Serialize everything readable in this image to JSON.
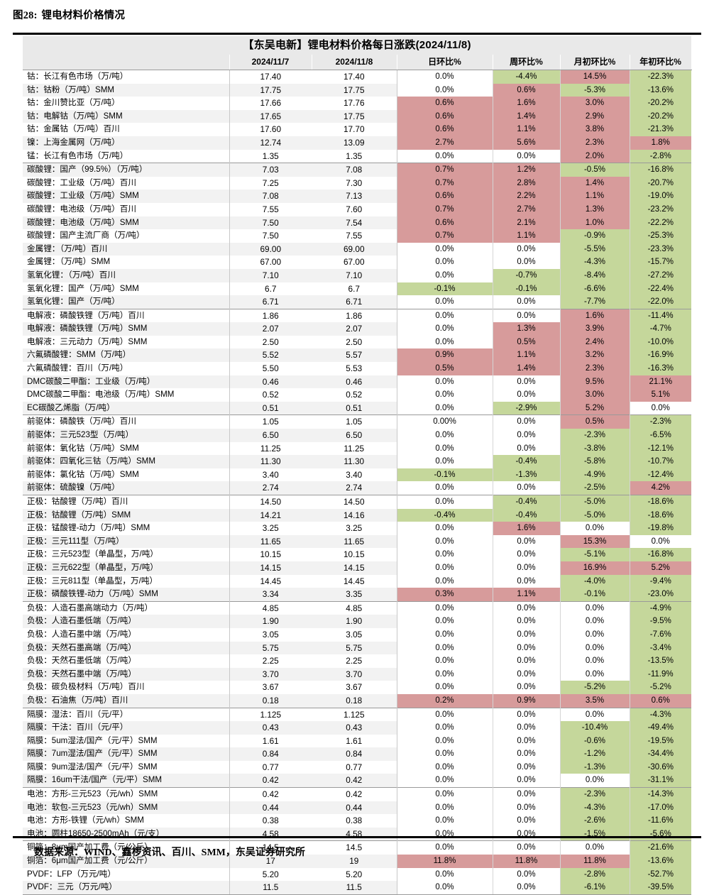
{
  "figure": {
    "number": "图28:",
    "caption": "锂电材料价格情况"
  },
  "source": {
    "text": "数据来源：WIND、鑫椤资讯、百川、SMM，东吴证券研究所"
  },
  "colors": {
    "up": "#d79b9b",
    "down": "#c5d79b",
    "flat": "#ffffff",
    "header_bg": "#e9e9e9",
    "stripe_bg": "#f2f2f2"
  },
  "table": {
    "title": "【东吴电新】锂电材料价格每日涨跌(2024/11/8)",
    "columns": [
      "",
      "2024/11/7",
      "2024/11/8",
      "日环比%",
      "周环比%",
      "月初环比%",
      "年初环比%"
    ],
    "rows": [
      {
        "name": "钴：长江有色市场（万/吨）",
        "v1": "17.40",
        "v2": "17.40",
        "d": "0.0%",
        "w": "-4.4%",
        "m": "14.5%",
        "y": "-22.3%",
        "dc": "flat",
        "wc": "down",
        "mc": "up",
        "yc": "down",
        "group": 1
      },
      {
        "name": "钴：钴粉（万/吨）SMM",
        "v1": "17.75",
        "v2": "17.75",
        "d": "0.0%",
        "w": "0.6%",
        "m": "-5.3%",
        "y": "-13.6%",
        "dc": "flat",
        "wc": "up",
        "mc": "down",
        "yc": "down",
        "group": 1
      },
      {
        "name": "钴：金川赞比亚（万/吨）",
        "v1": "17.66",
        "v2": "17.76",
        "d": "0.6%",
        "w": "1.6%",
        "m": "3.0%",
        "y": "-20.2%",
        "dc": "up",
        "wc": "up",
        "mc": "up",
        "yc": "down",
        "group": 1
      },
      {
        "name": "钴：电解钴（万/吨）SMM",
        "v1": "17.65",
        "v2": "17.75",
        "d": "0.6%",
        "w": "1.4%",
        "m": "2.9%",
        "y": "-20.2%",
        "dc": "up",
        "wc": "up",
        "mc": "up",
        "yc": "down",
        "group": 1
      },
      {
        "name": "钴：金属钴（万/吨）百川",
        "v1": "17.60",
        "v2": "17.70",
        "d": "0.6%",
        "w": "1.1%",
        "m": "3.8%",
        "y": "-21.3%",
        "dc": "up",
        "wc": "up",
        "mc": "up",
        "yc": "down",
        "group": 1
      },
      {
        "name": "镍：上海金属网（万/吨）",
        "v1": "12.74",
        "v2": "13.09",
        "d": "2.7%",
        "w": "5.6%",
        "m": "2.3%",
        "y": "1.8%",
        "dc": "up",
        "wc": "up",
        "mc": "up",
        "yc": "up",
        "group": 1
      },
      {
        "name": "锰：长江有色市场（万/吨）",
        "v1": "1.35",
        "v2": "1.35",
        "d": "0.0%",
        "w": "0.0%",
        "m": "2.0%",
        "y": "-2.8%",
        "dc": "flat",
        "wc": "flat",
        "mc": "up",
        "yc": "down",
        "group": 1
      },
      {
        "name": "碳酸锂：国产（99.5%）（万/吨）",
        "v1": "7.03",
        "v2": "7.08",
        "d": "0.7%",
        "w": "1.2%",
        "m": "-0.5%",
        "y": "-16.8%",
        "dc": "up",
        "wc": "up",
        "mc": "down",
        "yc": "down",
        "group": 2
      },
      {
        "name": "碳酸锂：工业级（万/吨）百川",
        "v1": "7.25",
        "v2": "7.30",
        "d": "0.7%",
        "w": "2.8%",
        "m": "1.4%",
        "y": "-20.7%",
        "dc": "up",
        "wc": "up",
        "mc": "up",
        "yc": "down",
        "group": 2
      },
      {
        "name": "碳酸锂：工业级（万/吨）SMM",
        "v1": "7.08",
        "v2": "7.13",
        "d": "0.6%",
        "w": "2.2%",
        "m": "1.1%",
        "y": "-19.0%",
        "dc": "up",
        "wc": "up",
        "mc": "up",
        "yc": "down",
        "group": 2
      },
      {
        "name": "碳酸锂：电池级（万/吨）百川",
        "v1": "7.55",
        "v2": "7.60",
        "d": "0.7%",
        "w": "2.7%",
        "m": "1.3%",
        "y": "-23.2%",
        "dc": "up",
        "wc": "up",
        "mc": "up",
        "yc": "down",
        "group": 2
      },
      {
        "name": "碳酸锂：电池级（万/吨）SMM",
        "v1": "7.50",
        "v2": "7.54",
        "d": "0.6%",
        "w": "2.1%",
        "m": "1.0%",
        "y": "-22.2%",
        "dc": "up",
        "wc": "up",
        "mc": "up",
        "yc": "down",
        "group": 2
      },
      {
        "name": "碳酸锂：国产主流厂商（万/吨）",
        "v1": "7.50",
        "v2": "7.55",
        "d": "0.7%",
        "w": "1.1%",
        "m": "-0.9%",
        "y": "-25.3%",
        "dc": "up",
        "wc": "up",
        "mc": "down",
        "yc": "down",
        "group": 2
      },
      {
        "name": "金属锂：（万/吨）百川",
        "v1": "69.00",
        "v2": "69.00",
        "d": "0.0%",
        "w": "0.0%",
        "m": "-5.5%",
        "y": "-23.3%",
        "dc": "flat",
        "wc": "flat",
        "mc": "down",
        "yc": "down",
        "group": 2
      },
      {
        "name": "金属锂：（万/吨）SMM",
        "v1": "67.00",
        "v2": "67.00",
        "d": "0.0%",
        "w": "0.0%",
        "m": "-4.3%",
        "y": "-15.7%",
        "dc": "flat",
        "wc": "flat",
        "mc": "down",
        "yc": "down",
        "group": 2
      },
      {
        "name": "氢氧化锂：（万/吨）百川",
        "v1": "7.10",
        "v2": "7.10",
        "d": "0.0%",
        "w": "-0.7%",
        "m": "-8.4%",
        "y": "-27.2%",
        "dc": "flat",
        "wc": "down",
        "mc": "down",
        "yc": "down",
        "group": 2
      },
      {
        "name": "氢氧化锂：国产（万/吨）SMM",
        "v1": "6.7",
        "v2": "6.7",
        "d": "-0.1%",
        "w": "-0.1%",
        "m": "-6.6%",
        "y": "-22.4%",
        "dc": "down",
        "wc": "down",
        "mc": "down",
        "yc": "down",
        "group": 2
      },
      {
        "name": "氢氧化锂：国产（万/吨）",
        "v1": "6.71",
        "v2": "6.71",
        "d": "0.0%",
        "w": "0.0%",
        "m": "-7.7%",
        "y": "-22.0%",
        "dc": "flat",
        "wc": "flat",
        "mc": "down",
        "yc": "down",
        "group": 2
      },
      {
        "name": "电解液：磷酸铁锂（万/吨）百川",
        "v1": "1.86",
        "v2": "1.86",
        "d": "0.0%",
        "w": "0.0%",
        "m": "1.6%",
        "y": "-11.4%",
        "dc": "flat",
        "wc": "flat",
        "mc": "up",
        "yc": "down",
        "group": 3
      },
      {
        "name": "电解液：磷酸铁锂（万/吨）SMM",
        "v1": "2.07",
        "v2": "2.07",
        "d": "0.0%",
        "w": "1.3%",
        "m": "3.9%",
        "y": "-4.7%",
        "dc": "flat",
        "wc": "up",
        "mc": "up",
        "yc": "down",
        "group": 3
      },
      {
        "name": "电解液：三元动力（万/吨）SMM",
        "v1": "2.50",
        "v2": "2.50",
        "d": "0.0%",
        "w": "0.5%",
        "m": "2.4%",
        "y": "-10.0%",
        "dc": "flat",
        "wc": "up",
        "mc": "up",
        "yc": "down",
        "group": 3
      },
      {
        "name": "六氟磷酸锂：SMM（万/吨）",
        "v1": "5.52",
        "v2": "5.57",
        "d": "0.9%",
        "w": "1.1%",
        "m": "3.2%",
        "y": "-16.9%",
        "dc": "up",
        "wc": "up",
        "mc": "up",
        "yc": "down",
        "group": 3
      },
      {
        "name": "六氟磷酸锂：百川（万/吨）",
        "v1": "5.50",
        "v2": "5.53",
        "d": "0.5%",
        "w": "1.4%",
        "m": "2.3%",
        "y": "-16.3%",
        "dc": "up",
        "wc": "up",
        "mc": "up",
        "yc": "down",
        "group": 3
      },
      {
        "name": "DMC碳酸二甲酯：工业级（万/吨）",
        "v1": "0.46",
        "v2": "0.46",
        "d": "0.0%",
        "w": "0.0%",
        "m": "9.5%",
        "y": "21.1%",
        "dc": "flat",
        "wc": "flat",
        "mc": "up",
        "yc": "up",
        "group": 3
      },
      {
        "name": "DMC碳酸二甲酯：电池级（万/吨）SMM",
        "v1": "0.52",
        "v2": "0.52",
        "d": "0.0%",
        "w": "0.0%",
        "m": "3.0%",
        "y": "5.1%",
        "dc": "flat",
        "wc": "flat",
        "mc": "up",
        "yc": "up",
        "group": 3
      },
      {
        "name": "EC碳酸乙烯脂（万/吨）",
        "v1": "0.51",
        "v2": "0.51",
        "d": "0.0%",
        "w": "-2.9%",
        "m": "5.2%",
        "y": "0.0%",
        "dc": "flat",
        "wc": "down",
        "mc": "up",
        "yc": "flat",
        "group": 3
      },
      {
        "name": "前驱体：磷酸铁（万/吨）百川",
        "v1": "1.05",
        "v2": "1.05",
        "d": "0.00%",
        "w": "0.0%",
        "m": "0.5%",
        "y": "-2.3%",
        "dc": "flat",
        "wc": "flat",
        "mc": "up",
        "yc": "down",
        "group": 4
      },
      {
        "name": "前驱体：三元523型（万/吨）",
        "v1": "6.50",
        "v2": "6.50",
        "d": "0.0%",
        "w": "0.0%",
        "m": "-2.3%",
        "y": "-6.5%",
        "dc": "flat",
        "wc": "flat",
        "mc": "down",
        "yc": "down",
        "group": 4
      },
      {
        "name": "前驱体：氧化钴（万/吨）SMM",
        "v1": "11.25",
        "v2": "11.25",
        "d": "0.0%",
        "w": "0.0%",
        "m": "-3.8%",
        "y": "-12.1%",
        "dc": "flat",
        "wc": "flat",
        "mc": "down",
        "yc": "down",
        "group": 4
      },
      {
        "name": "前驱体：四氧化三钴（万/吨）SMM",
        "v1": "11.30",
        "v2": "11.30",
        "d": "0.0%",
        "w": "-0.4%",
        "m": "-5.8%",
        "y": "-10.7%",
        "dc": "flat",
        "wc": "down",
        "mc": "down",
        "yc": "down",
        "group": 4
      },
      {
        "name": "前驱体：氯化钴（万/吨）SMM",
        "v1": "3.40",
        "v2": "3.40",
        "d": "-0.1%",
        "w": "-1.3%",
        "m": "-4.9%",
        "y": "-12.4%",
        "dc": "down",
        "wc": "down",
        "mc": "down",
        "yc": "down",
        "group": 4
      },
      {
        "name": "前驱体：硫酸镍（万/吨）",
        "v1": "2.74",
        "v2": "2.74",
        "d": "0.0%",
        "w": "0.0%",
        "m": "-2.5%",
        "y": "4.2%",
        "dc": "flat",
        "wc": "flat",
        "mc": "down",
        "yc": "up",
        "group": 4
      },
      {
        "name": "正极：钴酸锂（万/吨）百川",
        "v1": "14.50",
        "v2": "14.50",
        "d": "0.0%",
        "w": "-0.4%",
        "m": "-5.0%",
        "y": "-18.6%",
        "dc": "flat",
        "wc": "down",
        "mc": "down",
        "yc": "down",
        "group": 5
      },
      {
        "name": "正极：钴酸锂（万/吨）SMM",
        "v1": "14.21",
        "v2": "14.16",
        "d": "-0.4%",
        "w": "-0.4%",
        "m": "-5.0%",
        "y": "-18.6%",
        "dc": "down",
        "wc": "down",
        "mc": "down",
        "yc": "down",
        "group": 5
      },
      {
        "name": "正极：锰酸锂-动力（万/吨）SMM",
        "v1": "3.25",
        "v2": "3.25",
        "d": "0.0%",
        "w": "1.6%",
        "m": "0.0%",
        "y": "-19.8%",
        "dc": "flat",
        "wc": "up",
        "mc": "flat",
        "yc": "down",
        "group": 5
      },
      {
        "name": "正极：三元111型（万/吨）",
        "v1": "11.65",
        "v2": "11.65",
        "d": "0.0%",
        "w": "0.0%",
        "m": "15.3%",
        "y": "0.0%",
        "dc": "flat",
        "wc": "flat",
        "mc": "up",
        "yc": "flat",
        "group": 5
      },
      {
        "name": "正极：三元523型（单晶型，万/吨）",
        "v1": "10.15",
        "v2": "10.15",
        "d": "0.0%",
        "w": "0.0%",
        "m": "-5.1%",
        "y": "-16.8%",
        "dc": "flat",
        "wc": "flat",
        "mc": "down",
        "yc": "down",
        "group": 5
      },
      {
        "name": "正极：三元622型（单晶型，万/吨）",
        "v1": "14.15",
        "v2": "14.15",
        "d": "0.0%",
        "w": "0.0%",
        "m": "16.9%",
        "y": "5.2%",
        "dc": "flat",
        "wc": "flat",
        "mc": "up",
        "yc": "up",
        "group": 5
      },
      {
        "name": "正极：三元811型（单晶型，万/吨）",
        "v1": "14.45",
        "v2": "14.45",
        "d": "0.0%",
        "w": "0.0%",
        "m": "-4.0%",
        "y": "-9.4%",
        "dc": "flat",
        "wc": "flat",
        "mc": "down",
        "yc": "down",
        "group": 5
      },
      {
        "name": "正极：磷酸铁锂-动力（万/吨）SMM",
        "v1": "3.34",
        "v2": "3.35",
        "d": "0.3%",
        "w": "1.1%",
        "m": "-0.1%",
        "y": "-23.0%",
        "dc": "up",
        "wc": "up",
        "mc": "down",
        "yc": "down",
        "group": 5
      },
      {
        "name": "负极：人造石墨高端动力（万/吨）",
        "v1": "4.85",
        "v2": "4.85",
        "d": "0.0%",
        "w": "0.0%",
        "m": "0.0%",
        "y": "-4.9%",
        "dc": "flat",
        "wc": "flat",
        "mc": "flat",
        "yc": "down",
        "group": 6
      },
      {
        "name": "负极：人造石墨低端（万/吨）",
        "v1": "1.90",
        "v2": "1.90",
        "d": "0.0%",
        "w": "0.0%",
        "m": "0.0%",
        "y": "-9.5%",
        "dc": "flat",
        "wc": "flat",
        "mc": "flat",
        "yc": "down",
        "group": 6
      },
      {
        "name": "负极：人造石墨中端（万/吨）",
        "v1": "3.05",
        "v2": "3.05",
        "d": "0.0%",
        "w": "0.0%",
        "m": "0.0%",
        "y": "-7.6%",
        "dc": "flat",
        "wc": "flat",
        "mc": "flat",
        "yc": "down",
        "group": 6
      },
      {
        "name": "负极：天然石墨高端（万/吨）",
        "v1": "5.75",
        "v2": "5.75",
        "d": "0.0%",
        "w": "0.0%",
        "m": "0.0%",
        "y": "-3.4%",
        "dc": "flat",
        "wc": "flat",
        "mc": "flat",
        "yc": "down",
        "group": 6
      },
      {
        "name": "负极：天然石墨低端（万/吨）",
        "v1": "2.25",
        "v2": "2.25",
        "d": "0.0%",
        "w": "0.0%",
        "m": "0.0%",
        "y": "-13.5%",
        "dc": "flat",
        "wc": "flat",
        "mc": "flat",
        "yc": "down",
        "group": 6
      },
      {
        "name": "负极：天然石墨中端（万/吨）",
        "v1": "3.70",
        "v2": "3.70",
        "d": "0.0%",
        "w": "0.0%",
        "m": "0.0%",
        "y": "-11.9%",
        "dc": "flat",
        "wc": "flat",
        "mc": "flat",
        "yc": "down",
        "group": 6
      },
      {
        "name": "负极：碳负极材料（万/吨）百川",
        "v1": "3.67",
        "v2": "3.67",
        "d": "0.0%",
        "w": "0.0%",
        "m": "-5.2%",
        "y": "-5.2%",
        "dc": "flat",
        "wc": "flat",
        "mc": "down",
        "yc": "down",
        "group": 6
      },
      {
        "name": "负极：石油焦（万/吨）百川",
        "v1": "0.18",
        "v2": "0.18",
        "d": "0.2%",
        "w": "0.9%",
        "m": "3.5%",
        "y": "0.6%",
        "dc": "up",
        "wc": "up",
        "mc": "up",
        "yc": "up",
        "group": 6
      },
      {
        "name": "隔膜：湿法：百川（元/平）",
        "v1": "1.125",
        "v2": "1.125",
        "d": "0.0%",
        "w": "0.0%",
        "m": "0.0%",
        "y": "-4.3%",
        "dc": "flat",
        "wc": "flat",
        "mc": "flat",
        "yc": "down",
        "group": 7
      },
      {
        "name": "隔膜：干法：百川（元/平）",
        "v1": "0.43",
        "v2": "0.43",
        "d": "0.0%",
        "w": "0.0%",
        "m": "-10.4%",
        "y": "-49.4%",
        "dc": "flat",
        "wc": "flat",
        "mc": "down",
        "yc": "down",
        "group": 7
      },
      {
        "name": "隔膜：5um湿法/国产（元/平）SMM",
        "v1": "1.61",
        "v2": "1.61",
        "d": "0.0%",
        "w": "0.0%",
        "m": "-0.6%",
        "y": "-19.5%",
        "dc": "flat",
        "wc": "flat",
        "mc": "down",
        "yc": "down",
        "group": 7
      },
      {
        "name": "隔膜：7um湿法/国产（元/平）SMM",
        "v1": "0.84",
        "v2": "0.84",
        "d": "0.0%",
        "w": "0.0%",
        "m": "-1.2%",
        "y": "-34.4%",
        "dc": "flat",
        "wc": "flat",
        "mc": "down",
        "yc": "down",
        "group": 7
      },
      {
        "name": "隔膜：9um湿法/国产（元/平）SMM",
        "v1": "0.77",
        "v2": "0.77",
        "d": "0.0%",
        "w": "0.0%",
        "m": "-1.3%",
        "y": "-30.6%",
        "dc": "flat",
        "wc": "flat",
        "mc": "down",
        "yc": "down",
        "group": 7
      },
      {
        "name": "隔膜：16um干法/国产（元/平）SMM",
        "v1": "0.42",
        "v2": "0.42",
        "d": "0.0%",
        "w": "0.0%",
        "m": "0.0%",
        "y": "-31.1%",
        "dc": "flat",
        "wc": "flat",
        "mc": "flat",
        "yc": "down",
        "group": 7
      },
      {
        "name": "电池：方形-三元523（元/wh）SMM",
        "v1": "0.42",
        "v2": "0.42",
        "d": "0.0%",
        "w": "0.0%",
        "m": "-2.3%",
        "y": "-14.3%",
        "dc": "flat",
        "wc": "flat",
        "mc": "down",
        "yc": "down",
        "group": 8
      },
      {
        "name": "电池：软包-三元523（元/wh）SMM",
        "v1": "0.44",
        "v2": "0.44",
        "d": "0.0%",
        "w": "0.0%",
        "m": "-4.3%",
        "y": "-17.0%",
        "dc": "flat",
        "wc": "flat",
        "mc": "down",
        "yc": "down",
        "group": 8
      },
      {
        "name": "电池：方形-铁锂（元/wh）SMM",
        "v1": "0.38",
        "v2": "0.38",
        "d": "0.0%",
        "w": "0.0%",
        "m": "-2.6%",
        "y": "-11.6%",
        "dc": "flat",
        "wc": "flat",
        "mc": "down",
        "yc": "down",
        "group": 8
      },
      {
        "name": "电池：圆柱18650-2500mAh（元/支）",
        "v1": "4.58",
        "v2": "4.58",
        "d": "0.0%",
        "w": "0.0%",
        "m": "-1.5%",
        "y": "-5.6%",
        "dc": "flat",
        "wc": "flat",
        "mc": "down",
        "yc": "down",
        "group": 8
      },
      {
        "name": "铜箔：8μm国产加工费（元/公斤）",
        "v1": "14.5",
        "v2": "14.5",
        "d": "0.0%",
        "w": "0.0%",
        "m": "0.0%",
        "y": "-21.6%",
        "dc": "flat",
        "wc": "flat",
        "mc": "flat",
        "yc": "down",
        "group": 9
      },
      {
        "name": "铜箔：6μm国产加工费（元/公斤）",
        "v1": "17",
        "v2": "19",
        "d": "11.8%",
        "w": "11.8%",
        "m": "11.8%",
        "y": "-13.6%",
        "dc": "up",
        "wc": "up",
        "mc": "up",
        "yc": "down",
        "group": 9
      },
      {
        "name": "PVDF：LFP（万元/吨）",
        "v1": "5.20",
        "v2": "5.20",
        "d": "0.0%",
        "w": "0.0%",
        "m": "-2.8%",
        "y": "-52.7%",
        "dc": "flat",
        "wc": "flat",
        "mc": "down",
        "yc": "down",
        "group": 9
      },
      {
        "name": "PVDF：三元（万元/吨）",
        "v1": "11.5",
        "v2": "11.5",
        "d": "0.0%",
        "w": "0.0%",
        "m": "-6.1%",
        "y": "-39.5%",
        "dc": "flat",
        "wc": "flat",
        "mc": "down",
        "yc": "down",
        "group": 9
      }
    ]
  }
}
